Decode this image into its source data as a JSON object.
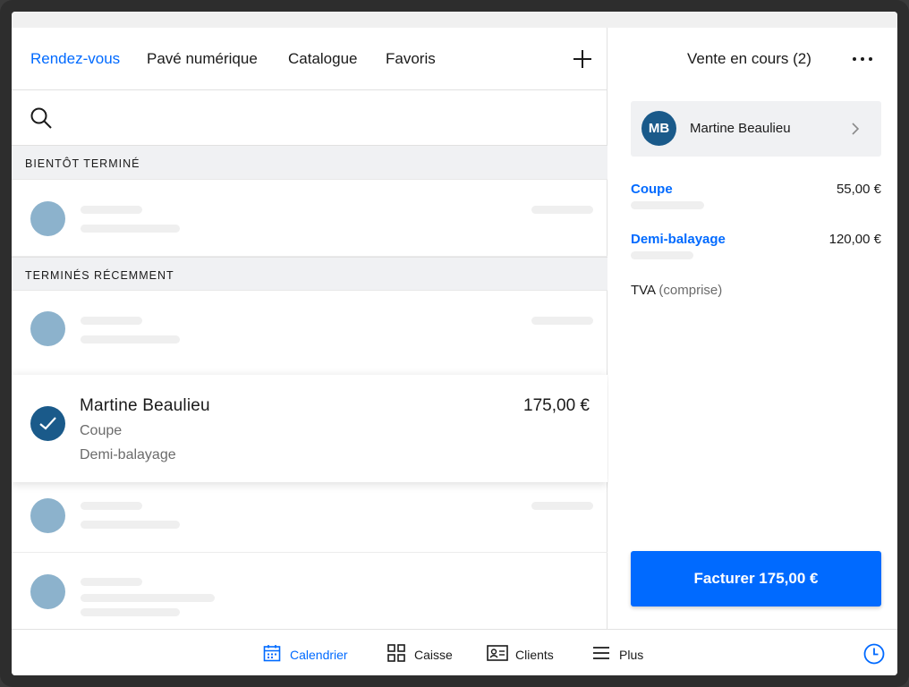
{
  "tabs": [
    {
      "label": "Rendez-vous",
      "active": true
    },
    {
      "label": "Pavé numérique"
    },
    {
      "label": "Catalogue"
    },
    {
      "label": "Favoris"
    }
  ],
  "search": {
    "placeholder": ""
  },
  "sections": {
    "soon": "BIENTÔT TERMINÉ",
    "recent": "TERMINÉS RÉCEMMENT"
  },
  "selected_appointment": {
    "name": "Martine Beaulieu",
    "price": "175,00 €",
    "services": [
      "Coupe",
      "Demi-balayage"
    ]
  },
  "sale": {
    "title": "Vente en cours (2)",
    "customer": {
      "initials": "MB",
      "name": "Martine Beaulieu"
    },
    "items": [
      {
        "name": "Coupe",
        "price": "55,00 €"
      },
      {
        "name": "Demi-balayage",
        "price": "120,00 €"
      }
    ],
    "tax_label": "TVA",
    "tax_note": "(comprise)",
    "charge_label": "Facturer 175,00 €"
  },
  "bottom_nav": [
    {
      "label": "Calendrier",
      "icon": "calendar-icon",
      "active": true
    },
    {
      "label": "Caisse",
      "icon": "grid-icon"
    },
    {
      "label": "Clients",
      "icon": "contact-card-icon"
    },
    {
      "label": "Plus",
      "icon": "menu-icon"
    }
  ],
  "colors": {
    "accent": "#006aff",
    "avatar_dark": "#1a5a8a",
    "avatar_placeholder": "#8cb2cc",
    "section_bg": "#f0f1f3"
  }
}
